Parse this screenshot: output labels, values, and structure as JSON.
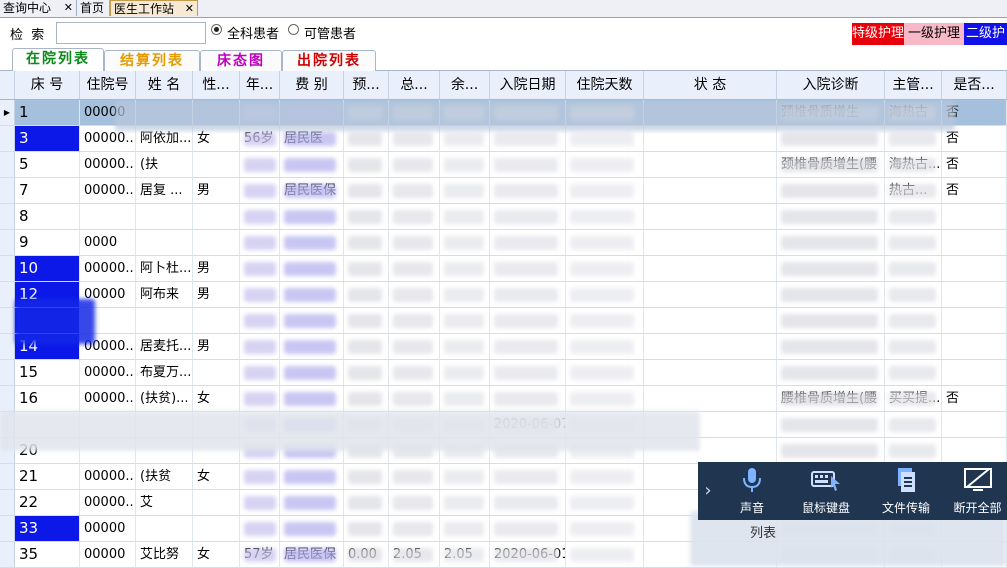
{
  "tabs": [
    {
      "label": "查询中心",
      "close": "✕"
    },
    {
      "label": "首页",
      "close": ""
    },
    {
      "label": "医生工作站",
      "close": "✕"
    }
  ],
  "search": {
    "label": "检  索",
    "value": "",
    "radio_all": "全科患者",
    "radio_managed": "可管患者"
  },
  "legend": [
    {
      "label": "特级护理",
      "bg": "#e8000b",
      "color": "#ffffff"
    },
    {
      "label": "一级护理",
      "bg": "#f7b8c8",
      "color": "#000000"
    },
    {
      "label": "二级护理",
      "bg": "#1010e8",
      "color": "#ffffff"
    }
  ],
  "subtabs": [
    {
      "label": "在院列表",
      "color": "#0a8a1a"
    },
    {
      "label": "结算列表",
      "color": "#e69b00"
    },
    {
      "label": "床态图",
      "color": "#c000c0"
    },
    {
      "label": "出院列表",
      "color": "#d00000"
    }
  ],
  "columns": [
    "床 号",
    "住院号",
    "姓 名",
    "性...",
    "年...",
    "费 别",
    "预...",
    "总...",
    "余...",
    "入院日期",
    "住院天数",
    "状 态",
    "入院诊断",
    "主管...",
    "是否..."
  ],
  "rows": [
    {
      "bed": "1",
      "adm": "00000",
      "name": "",
      "sex": "",
      "age": "",
      "fee": "",
      "pre": "",
      "tot": "",
      "bal": "",
      "date": "",
      "days": "",
      "status": "",
      "diag": "颈椎骨质增生",
      "doc": "海热古",
      "flag": "否",
      "blue": false,
      "sel": true
    },
    {
      "bed": "3",
      "adm": "00000...",
      "name": "阿依加...",
      "sex": "女",
      "age": "56岁",
      "fee": "居民医",
      "pre": "",
      "tot": "",
      "bal": "",
      "date": "",
      "days": "",
      "status": "",
      "diag": "",
      "doc": "",
      "flag": "否",
      "blue": true,
      "sel": false
    },
    {
      "bed": "5",
      "adm": "00000...",
      "name": "(扶",
      "sex": "",
      "age": "",
      "fee": "",
      "pre": "",
      "tot": "",
      "bal": "",
      "date": "",
      "days": "",
      "status": "",
      "diag": "颈椎骨质增生(腰",
      "doc": "海热古...",
      "flag": "否",
      "blue": false,
      "sel": false
    },
    {
      "bed": "7",
      "adm": "00000...",
      "name": "居复 ...",
      "sex": "男",
      "age": "",
      "fee": "居民医保",
      "pre": "",
      "tot": "",
      "bal": "",
      "date": "",
      "days": "",
      "status": "",
      "diag": "",
      "doc": "热古...",
      "flag": "否",
      "blue": false,
      "sel": false
    },
    {
      "bed": "8",
      "adm": "",
      "name": "",
      "sex": "",
      "age": "",
      "fee": "",
      "pre": "",
      "tot": "",
      "bal": "",
      "date": "",
      "days": "",
      "status": "",
      "diag": "",
      "doc": "",
      "flag": "",
      "blue": false,
      "sel": false
    },
    {
      "bed": "9",
      "adm": "0000",
      "name": "",
      "sex": "",
      "age": "",
      "fee": "",
      "pre": "",
      "tot": "",
      "bal": "",
      "date": "",
      "days": "",
      "status": "",
      "diag": "",
      "doc": "",
      "flag": "",
      "blue": false,
      "sel": false
    },
    {
      "bed": "10",
      "adm": "00000...",
      "name": "阿卜杜...",
      "sex": "男",
      "age": "",
      "fee": "",
      "pre": "",
      "tot": "",
      "bal": "",
      "date": "",
      "days": "",
      "status": "",
      "diag": "",
      "doc": "",
      "flag": "",
      "blue": true,
      "sel": false
    },
    {
      "bed": "12",
      "adm": "00000",
      "name": "阿布来",
      "sex": "男",
      "age": "",
      "fee": "",
      "pre": "",
      "tot": "",
      "bal": "",
      "date": "",
      "days": "",
      "status": "",
      "diag": "",
      "doc": "",
      "flag": "",
      "blue": true,
      "sel": false
    },
    {
      "bed": "",
      "adm": "",
      "name": "",
      "sex": "",
      "age": "",
      "fee": "",
      "pre": "",
      "tot": "",
      "bal": "",
      "date": "",
      "days": "",
      "status": "",
      "diag": "",
      "doc": "",
      "flag": "",
      "blue": true,
      "sel": false
    },
    {
      "bed": "14",
      "adm": "00000...",
      "name": "居麦托...",
      "sex": "男",
      "age": "",
      "fee": "",
      "pre": "",
      "tot": "",
      "bal": "",
      "date": "",
      "days": "",
      "status": "",
      "diag": "",
      "doc": "",
      "flag": "",
      "blue": true,
      "sel": false
    },
    {
      "bed": "15",
      "adm": "00000...",
      "name": "布夏万...",
      "sex": "",
      "age": "",
      "fee": "",
      "pre": "",
      "tot": "",
      "bal": "",
      "date": "",
      "days": "",
      "status": "",
      "diag": "",
      "doc": "",
      "flag": "",
      "blue": false,
      "sel": false
    },
    {
      "bed": "16",
      "adm": "00000...",
      "name": "(扶贫)...",
      "sex": "女",
      "age": "",
      "fee": "",
      "pre": "",
      "tot": "",
      "bal": "",
      "date": "",
      "days": "",
      "status": "",
      "diag": "腰椎骨质增生(腰",
      "doc": "买买提...",
      "flag": "否",
      "blue": false,
      "sel": false
    },
    {
      "bed": "",
      "adm": "",
      "name": "",
      "sex": "",
      "age": "",
      "fee": "",
      "pre": "",
      "tot": "",
      "bal": "",
      "date": "2020-06-07",
      "days": "",
      "status": "",
      "diag": "",
      "doc": "",
      "flag": "",
      "blue": false,
      "sel": false
    },
    {
      "bed": "20",
      "adm": "",
      "name": "",
      "sex": "",
      "age": "",
      "fee": "",
      "pre": "",
      "tot": "",
      "bal": "",
      "date": "",
      "days": "",
      "status": "",
      "diag": "",
      "doc": "",
      "flag": "",
      "blue": false,
      "sel": false
    },
    {
      "bed": "21",
      "adm": "00000...",
      "name": "(扶贫",
      "sex": "女",
      "age": "",
      "fee": "",
      "pre": "",
      "tot": "",
      "bal": "",
      "date": "",
      "days": "",
      "status": "",
      "diag": "",
      "doc": "",
      "flag": "",
      "blue": false,
      "sel": false
    },
    {
      "bed": "22",
      "adm": "00000...",
      "name": "艾",
      "sex": "",
      "age": "",
      "fee": "",
      "pre": "",
      "tot": "",
      "bal": "",
      "date": "",
      "days": "",
      "status": "",
      "diag": "",
      "doc": "",
      "flag": "",
      "blue": false,
      "sel": false
    },
    {
      "bed": "33",
      "adm": "00000",
      "name": "",
      "sex": "",
      "age": "",
      "fee": "",
      "pre": "",
      "tot": "",
      "bal": "",
      "date": "",
      "days": "",
      "status": "",
      "diag": "",
      "doc": "",
      "flag": "",
      "blue": true,
      "sel": false
    },
    {
      "bed": "35",
      "adm": "00000",
      "name": "艾比努",
      "sex": "女",
      "age": "57岁",
      "fee": "居民医保",
      "pre": "0.00",
      "tot": "2.05",
      "bal": "2.05",
      "date": "2020-06-01",
      "days": "",
      "status": "",
      "diag": "",
      "doc": "",
      "flag": "",
      "blue": false,
      "sel": false
    }
  ],
  "remote": {
    "arrow": "›",
    "buttons": [
      {
        "label": "声音",
        "icon": "microphone-icon"
      },
      {
        "label": "鼠标键盘",
        "icon": "mouse-keyboard-icon"
      },
      {
        "label": "文件传输",
        "icon": "file-transfer-icon"
      },
      {
        "label": "断开全部",
        "icon": "disconnect-icon"
      }
    ],
    "footer": "列表"
  }
}
